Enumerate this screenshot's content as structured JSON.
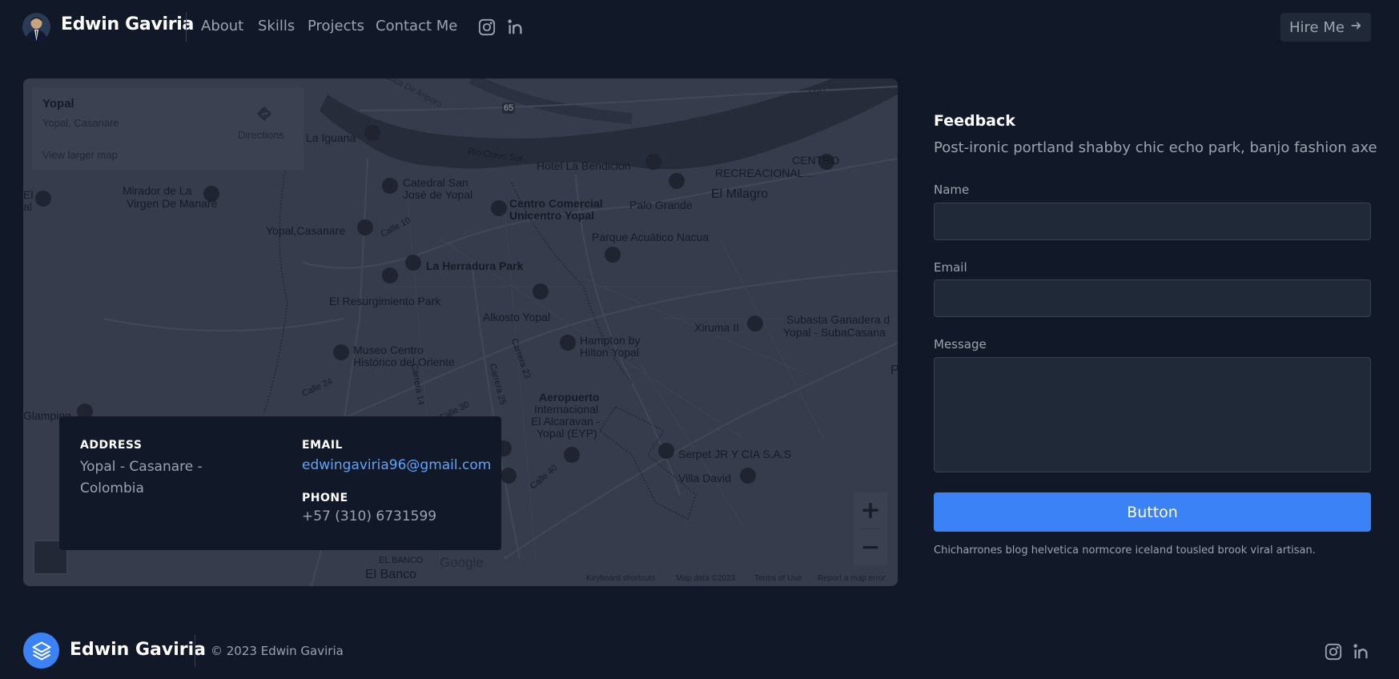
{
  "header": {
    "brand": "Edwin Gaviria",
    "nav": [
      "About",
      "Skills",
      "Projects",
      "Contact Me"
    ],
    "social_icons": [
      "instagram-icon",
      "linkedin-icon"
    ],
    "hire_label": "Hire Me",
    "hire_icon": "arrow-right-icon"
  },
  "map": {
    "place_title": "Yopal",
    "place_subtitle": "Yopal, Casanare",
    "directions_label": "Directions",
    "larger_map_label": "View larger map",
    "labels": {
      "la_iguana": "La Iguana",
      "hotel": "Hotel La Bendicion",
      "centro_rec_1": "CENTRO",
      "centro_rec_2": "RECREACIONAL...",
      "el_milagro": "El Milagro",
      "catedral_1": "Catedral San",
      "catedral_2": "José de Yopal",
      "mirador_1": "Mirador de La",
      "mirador_2": "Virgen De Manare",
      "unicentro_1": "Centro Comercial",
      "unicentro_2": "Unicentro Yopal",
      "palo_grande": "Palo Grande",
      "yopal_casanare": "Yopal,Casanare",
      "parque_acuatico": "Parque Acuático Nacua",
      "herradura": "La Herradura Park",
      "resurgimiento": "El Resurgimiento Park",
      "alkosto": "Alkosto Yopal",
      "xiruma": "Xiruma II",
      "subasta_1": "Subasta Ganadera d",
      "subasta_2": "Yopal - SubaCasana",
      "hampton_1": "Hampton by",
      "hampton_2": "Hilton Yopal",
      "museo_1": "Museo Centro",
      "museo_2": "Histórico del Oriente",
      "aeropuerto_1": "Aeropuerto",
      "aeropuerto_2": "Internacional",
      "aeropuerto_3": "El Alcaravan -",
      "aeropuerto_4": "Yopal (EYP)",
      "serpet": "Serpet JR Y CIA S.A.S",
      "villa_david": "Villa David",
      "glamping": "Glamping",
      "el_banco_caps": "EL BANCO",
      "el_banco": "El Banco",
      "rio_cravo": "Rio Cravo Sur",
      "road_65": "65",
      "calle_10": "Calle 10",
      "calle_24": "Calle 24",
      "calle_30": "Calle 30",
      "calle_40": "Calle 40",
      "carrera_14": "Carrera 14",
      "carrera_23": "Carrera 23",
      "carrera_25": "Carrera 25",
      "ariporo": "Vía Arauca De Ariporo",
      "rio_top": "Rio C",
      "el_left_1": "El",
      "el_left_2": "al",
      "p_right": "P"
    },
    "zoom_in": "+",
    "zoom_out": "−",
    "google": "Google",
    "attribution": [
      "Keyboard shortcuts",
      "Map data ©2023",
      "Terms of Use",
      "Report a map error"
    ]
  },
  "contact": {
    "address_heading": "ADDRESS",
    "address_line1": "Yopal - Casanare -",
    "address_line2": "Colombia",
    "email_heading": "EMAIL",
    "email": "edwingaviria96@gmail.com",
    "phone_heading": "PHONE",
    "phone": "+57 (310) 6731599"
  },
  "feedback": {
    "title": "Feedback",
    "description": "Post-ironic portland shabby chic echo park, banjo fashion axe",
    "name_label": "Name",
    "name_value": "",
    "email_label": "Email",
    "email_value": "",
    "message_label": "Message",
    "message_value": "",
    "button_label": "Button",
    "note": "Chicharrones blog helvetica normcore iceland tousled brook viral artisan."
  },
  "footer": {
    "brand": "Edwin Gaviria",
    "copyright": "© 2023 Edwin Gaviria",
    "logo_icon": "layers-icon",
    "social_icons": [
      "instagram-icon",
      "linkedin-icon"
    ]
  },
  "colors": {
    "background": "#111827",
    "panel": "#1f2937",
    "accent": "#3b82f6",
    "link": "#60a5fa",
    "text_muted": "#9ca3af"
  }
}
